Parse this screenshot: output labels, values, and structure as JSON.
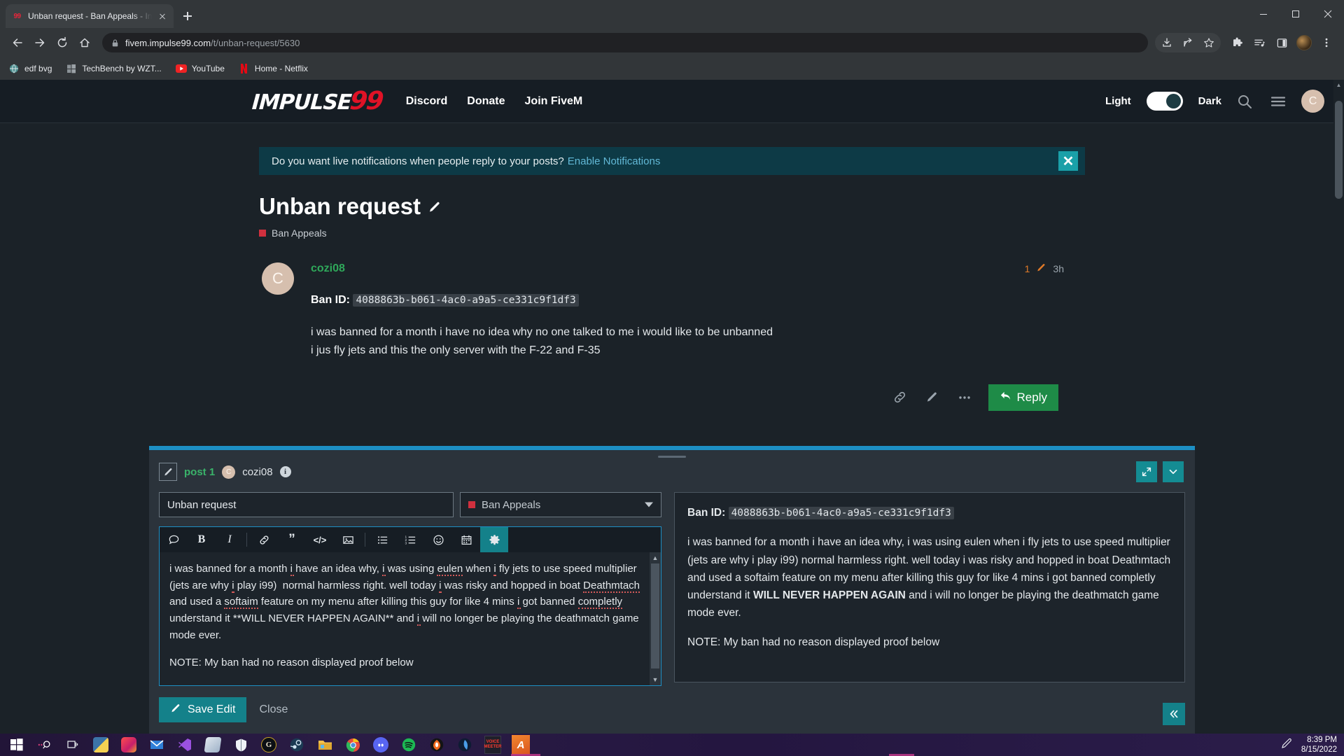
{
  "browser": {
    "tab": {
      "favicon_text": "99",
      "title": "Unban request - Ban Appeals - In"
    },
    "url_domain": "fivem.impulse99.com",
    "url_path": "/t/unban-request/5630",
    "bookmarks": [
      {
        "label": "edf bvg",
        "icon": "globe-icon"
      },
      {
        "label": "TechBench by WZT...",
        "icon": "windows-icon"
      },
      {
        "label": "YouTube",
        "icon": "youtube-icon"
      },
      {
        "label": "Home - Netflix",
        "icon": "netflix-icon"
      }
    ]
  },
  "site": {
    "logo_main": "IMPULSE",
    "logo_accent": "99",
    "nav": [
      "Discord",
      "Donate",
      "Join FiveM"
    ],
    "theme_light_label": "Light",
    "theme_dark_label": "Dark",
    "theme_mode": "Dark",
    "avatar_letter": "C"
  },
  "notice": {
    "text": "Do you want live notifications when people reply to your posts?",
    "link": "Enable Notifications",
    "close": "✕"
  },
  "topic": {
    "title": "Unban request",
    "category": "Ban Appeals",
    "category_color": "#d0303e"
  },
  "post": {
    "avatar_letter": "C",
    "author": "cozi08",
    "edit_count": "1",
    "time": "3h",
    "ban_id_label": "Ban ID:",
    "ban_id": "4088863b-b061-4ac0-a9a5-ce331c9f1df3",
    "line1": "i was banned for a month i have no idea why no one talked to me i would like to be unbanned",
    "line2": "i jus fly jets and this the only server with the F-22 and F-35",
    "reply_label": "Reply"
  },
  "composer": {
    "post_number": "post 1",
    "user": "cozi08",
    "user_avatar_letter": "C",
    "title_value": "Unban request",
    "category_value": "Ban Appeals",
    "toolbar_icons": [
      "chat-bubble-icon",
      "bold-icon",
      "italic-icon",
      "link-icon",
      "quote-icon",
      "code-icon",
      "image-icon",
      "bullet-list-icon",
      "numbered-list-icon",
      "emoji-icon",
      "calendar-icon",
      "gear-icon"
    ],
    "editor_text_p1": "i was banned for a month i have an idea why, i was using eulen when i fly jets to use speed multiplier (jets are why i play i99)  normal harmless right. well today i was risky and hopped in boat Deathmtach and used a softaim feature on my menu after killing this guy for like 4 mins i got banned completly understand it **WILL NEVER HAPPEN AGAIN** and i will no longer be playing the deathmatch game mode ever.",
    "editor_text_p2": "NOTE: My ban had no reason displayed proof below",
    "save_label": "Save Edit",
    "close_label": "Close"
  },
  "preview": {
    "ban_id_label": "Ban ID:",
    "ban_id": "4088863b-b061-4ac0-a9a5-ce331c9f1df3",
    "body_before_bold": "i was banned for a month i have an idea why, i was using eulen when i fly jets to use speed multiplier (jets are why i play i99) normal harmless right. well today i was risky and hopped in boat Deathmtach and used a softaim feature on my menu after killing this guy for like 4 mins i got banned completly understand it ",
    "body_bold": "WILL NEVER HAPPEN AGAIN",
    "body_after_bold": " and i will no longer be playing the deathmatch game mode ever.",
    "note": "NOTE: My ban had no reason displayed proof below"
  },
  "taskbar": {
    "apps": [
      "start-icon",
      "search-icon",
      "task-view-icon",
      "python-icon",
      "adobe-icon",
      "mail-icon",
      "visual-studio-icon",
      "onedrive-icon",
      "windows-security-icon",
      "league-icon",
      "steam-icon",
      "file-explorer-icon",
      "chrome-icon",
      "discord-icon",
      "spotify-icon",
      "brave-icon",
      "arc-icon",
      "voicemeeter-icon",
      "a-app-icon"
    ],
    "time": "8:39 PM",
    "date": "8/15/2022"
  },
  "colors": {
    "accent_teal": "#14818a",
    "accent_blue": "#1d8fc4",
    "brand_red": "#e01226",
    "reply_green": "#1e8b47",
    "page_bg": "#1b2228"
  }
}
